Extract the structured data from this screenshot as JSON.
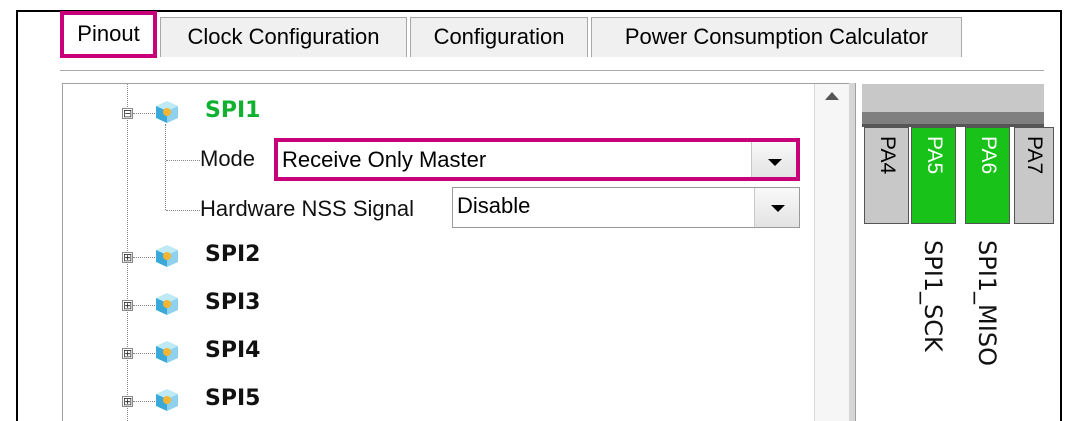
{
  "tabs": [
    {
      "label": "Pinout",
      "active": true
    },
    {
      "label": "Clock Configuration",
      "active": false
    },
    {
      "label": "Configuration",
      "active": false
    },
    {
      "label": "Power Consumption Calculator",
      "active": false
    }
  ],
  "tree": {
    "nodes": [
      {
        "label": "SPI1",
        "expanded": true,
        "expander": "⊟"
      },
      {
        "label": "SPI2",
        "expanded": false,
        "expander": "⊞"
      },
      {
        "label": "SPI3",
        "expanded": false,
        "expander": "⊞"
      },
      {
        "label": "SPI4",
        "expanded": false,
        "expander": "⊞"
      },
      {
        "label": "SPI5",
        "expanded": false,
        "expander": "⊞"
      }
    ],
    "spi1_props": {
      "mode_label": "Mode",
      "mode_value": "Receive Only Master",
      "nss_label": "Hardware NSS Signal",
      "nss_value": "Disable"
    }
  },
  "pins": [
    {
      "name": "PA4",
      "assigned": false
    },
    {
      "name": "PA5",
      "assigned": true,
      "signal": "SPI1_SCK"
    },
    {
      "name": "PA6",
      "assigned": true,
      "signal": "SPI1_MISO"
    },
    {
      "name": "PA7",
      "assigned": false
    }
  ],
  "colors": {
    "highlight": "#c8007a",
    "active_node": "#10b030",
    "assigned_pin": "#19c219"
  }
}
